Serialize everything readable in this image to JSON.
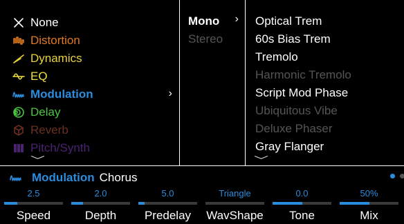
{
  "categories": {
    "items": [
      {
        "label": "None",
        "color": "#ffffff",
        "icon": "close-icon"
      },
      {
        "label": "Distortion",
        "color": "#e07a1f",
        "icon": "distortion-icon"
      },
      {
        "label": "Dynamics",
        "color": "#e8d33a",
        "icon": "dynamics-icon"
      },
      {
        "label": "EQ",
        "color": "#f0e040",
        "icon": "eq-icon"
      },
      {
        "label": "Modulation",
        "color": "#2a8cdc",
        "icon": "modulation-icon",
        "selected": true
      },
      {
        "label": "Delay",
        "color": "#4bc540",
        "icon": "delay-icon"
      },
      {
        "label": "Reverb",
        "color": "#6a2f1f",
        "icon": "reverb-icon"
      },
      {
        "label": "Pitch/Synth",
        "color": "#4a2270",
        "icon": "pitch-synth-icon"
      }
    ],
    "arrow": "›",
    "more_indicator": "﹀"
  },
  "modes": {
    "items": [
      {
        "label": "Mono",
        "active": true
      },
      {
        "label": "Stereo",
        "active": false
      }
    ],
    "arrow": "›"
  },
  "models": {
    "items": [
      {
        "label": "Optical Trem",
        "available": true
      },
      {
        "label": "60s Bias Trem",
        "available": true
      },
      {
        "label": "Tremolo",
        "available": true
      },
      {
        "label": "Harmonic Tremolo",
        "available": false
      },
      {
        "label": "Script Mod Phase",
        "available": true
      },
      {
        "label": "Ubiquitous Vibe",
        "available": false
      },
      {
        "label": "Deluxe Phaser",
        "available": false
      },
      {
        "label": "Gray Flanger",
        "available": true
      }
    ],
    "more_indicator": "﹀"
  },
  "block": {
    "category": "Modulation",
    "model": "Chorus",
    "icon": "modulation-icon"
  },
  "pager": {
    "pages": 2,
    "current": 1
  },
  "params": [
    {
      "label": "Speed",
      "value": "2.5",
      "level": 0.22
    },
    {
      "label": "Depth",
      "value": "2.0",
      "level": 0.2
    },
    {
      "label": "Predelay",
      "value": "5.0",
      "level": 0.1
    },
    {
      "label": "WavShape",
      "value": "Triangle",
      "level": 0.0
    },
    {
      "label": "Tone",
      "value": "0.0",
      "level": 0.5
    },
    {
      "label": "Mix",
      "value": "50%",
      "level": 0.5
    }
  ],
  "colors": {
    "accent": "#2a8cdc",
    "unavailable": "#555555",
    "track": "#3a3a3a"
  }
}
